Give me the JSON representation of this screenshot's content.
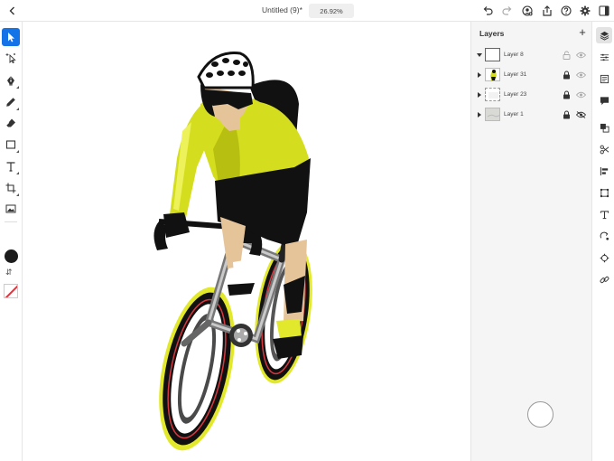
{
  "document": {
    "title": "Untitled (9)*",
    "zoom": "26.92%"
  },
  "layers_panel": {
    "title": "Layers",
    "add_symbol": "+",
    "layers": [
      {
        "name": "Layer 8",
        "locked": false,
        "visible": true,
        "selected": true
      },
      {
        "name": "Layer 31",
        "locked": true,
        "visible": true,
        "selected": false
      },
      {
        "name": "Layer 23",
        "locked": true,
        "visible": true,
        "selected": false
      },
      {
        "name": "Layer 1",
        "locked": true,
        "visible": false,
        "selected": false
      }
    ]
  },
  "left_tools": [
    "selection-tool",
    "direct-selection-tool",
    "pen-tool",
    "pencil-tool",
    "eraser-tool",
    "shape-tool",
    "type-tool",
    "crop-tool",
    "place-image-tool"
  ],
  "swap_symbol": "⇵",
  "colors": {
    "accent": "#1473e6",
    "fill": "#1c1c1c",
    "stroke": "#d7373f",
    "jersey_yellow": "#d4dd1e",
    "skin": "#e6c49a"
  }
}
